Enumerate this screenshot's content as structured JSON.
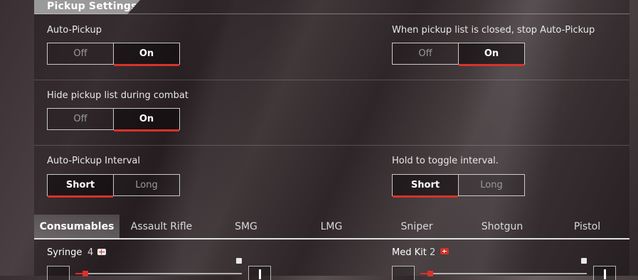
{
  "section": {
    "title": "Pickup Settings"
  },
  "settings": [
    {
      "label": "Auto-Pickup",
      "options": [
        "Off",
        "On"
      ],
      "selected": "On"
    },
    {
      "label": "When pickup list is closed, stop Auto-Pickup",
      "options": [
        "Off",
        "On"
      ],
      "selected": "On"
    },
    {
      "label": "Hide pickup list during combat",
      "options": [
        "Off",
        "On"
      ],
      "selected": "On"
    },
    {
      "label": "Auto-Pickup Interval",
      "options": [
        "Short",
        "Long"
      ],
      "selected": "Short"
    },
    {
      "label": "Hold to toggle interval.",
      "options": [
        "Short",
        "Long"
      ],
      "selected": "Short"
    }
  ],
  "tabs": [
    "Consumables",
    "Assault Rifle",
    "SMG",
    "LMG",
    "Sniper",
    "Shotgun",
    "Pistol"
  ],
  "active_tab": "Consumables",
  "items": [
    {
      "name": "Syringe",
      "count": "4",
      "icon": "syringe-badge-icon",
      "slider_fraction": 0.06
    },
    {
      "name": "Med Kit",
      "count": "2",
      "icon": "medkit-badge-icon",
      "slider_fraction": 0.06
    }
  ],
  "colors": {
    "accent": "#d8322b",
    "header_bg": "#9a9a9a"
  }
}
